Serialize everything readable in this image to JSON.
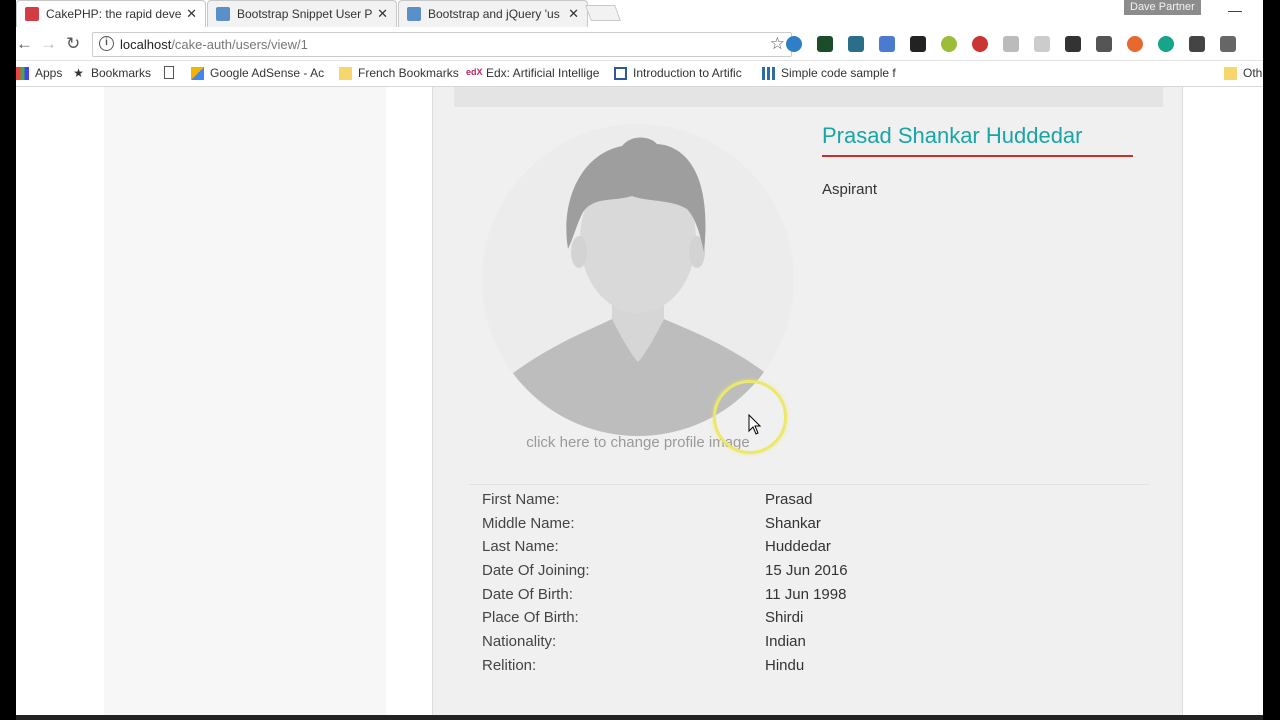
{
  "browser": {
    "tabs": [
      {
        "title": "CakePHP: the rapid deve",
        "favicon_color": "#d33c43",
        "active": true
      },
      {
        "title": "Bootstrap Snippet User P",
        "favicon_color": "#5b8fc7",
        "active": false
      },
      {
        "title": "Bootstrap and jQuery 'us",
        "favicon_color": "#5b8fc7",
        "active": false
      }
    ],
    "profile_name": "Dave Partner",
    "url_host": "localhost",
    "url_path": "/cake-auth/users/view/1",
    "close_glyph": "✕",
    "minimize_glyph": "—",
    "back_glyph": "←",
    "forward_glyph": "→",
    "reload_glyph": "↻",
    "star_glyph": "☆",
    "info_glyph": "i"
  },
  "bookmarks": [
    {
      "label": "Apps",
      "icon": "apps-grid-icon"
    },
    {
      "label": "Bookmarks",
      "icon": "star-icon"
    },
    {
      "label": "",
      "icon": "page-icon"
    },
    {
      "label": "Google AdSense - Ac",
      "icon": "adsense-icon"
    },
    {
      "label": "French Bookmarks",
      "icon": "folder-icon"
    },
    {
      "label": "Edx: Artificial Intellige",
      "icon": "edx-icon"
    },
    {
      "label": "Introduction to Artific",
      "icon": "course-icon"
    },
    {
      "label": "Simple code sample f",
      "icon": "grid-icon"
    },
    {
      "label": "Oth",
      "icon": "folder-icon"
    }
  ],
  "profile": {
    "full_name": "Prasad Shankar Huddedar",
    "role": "Aspirant",
    "change_image_text": "click here to change profile image",
    "fields": [
      {
        "label": "First Name:",
        "value": "Prasad"
      },
      {
        "label": "Middle Name:",
        "value": "Shankar"
      },
      {
        "label": "Last Name:",
        "value": "Huddedar"
      },
      {
        "label": "Date Of Joining:",
        "value": "15 Jun 2016"
      },
      {
        "label": "Date Of Birth:",
        "value": "11 Jun 1998"
      },
      {
        "label": "Place Of Birth:",
        "value": "Shirdi"
      },
      {
        "label": "Nationality:",
        "value": "Indian"
      },
      {
        "label": "Relition:",
        "value": "Hindu"
      }
    ]
  },
  "colors": {
    "name_accent": "#1aa5a5",
    "name_underline": "#c9302c",
    "card_bg": "#f0f0f0"
  }
}
